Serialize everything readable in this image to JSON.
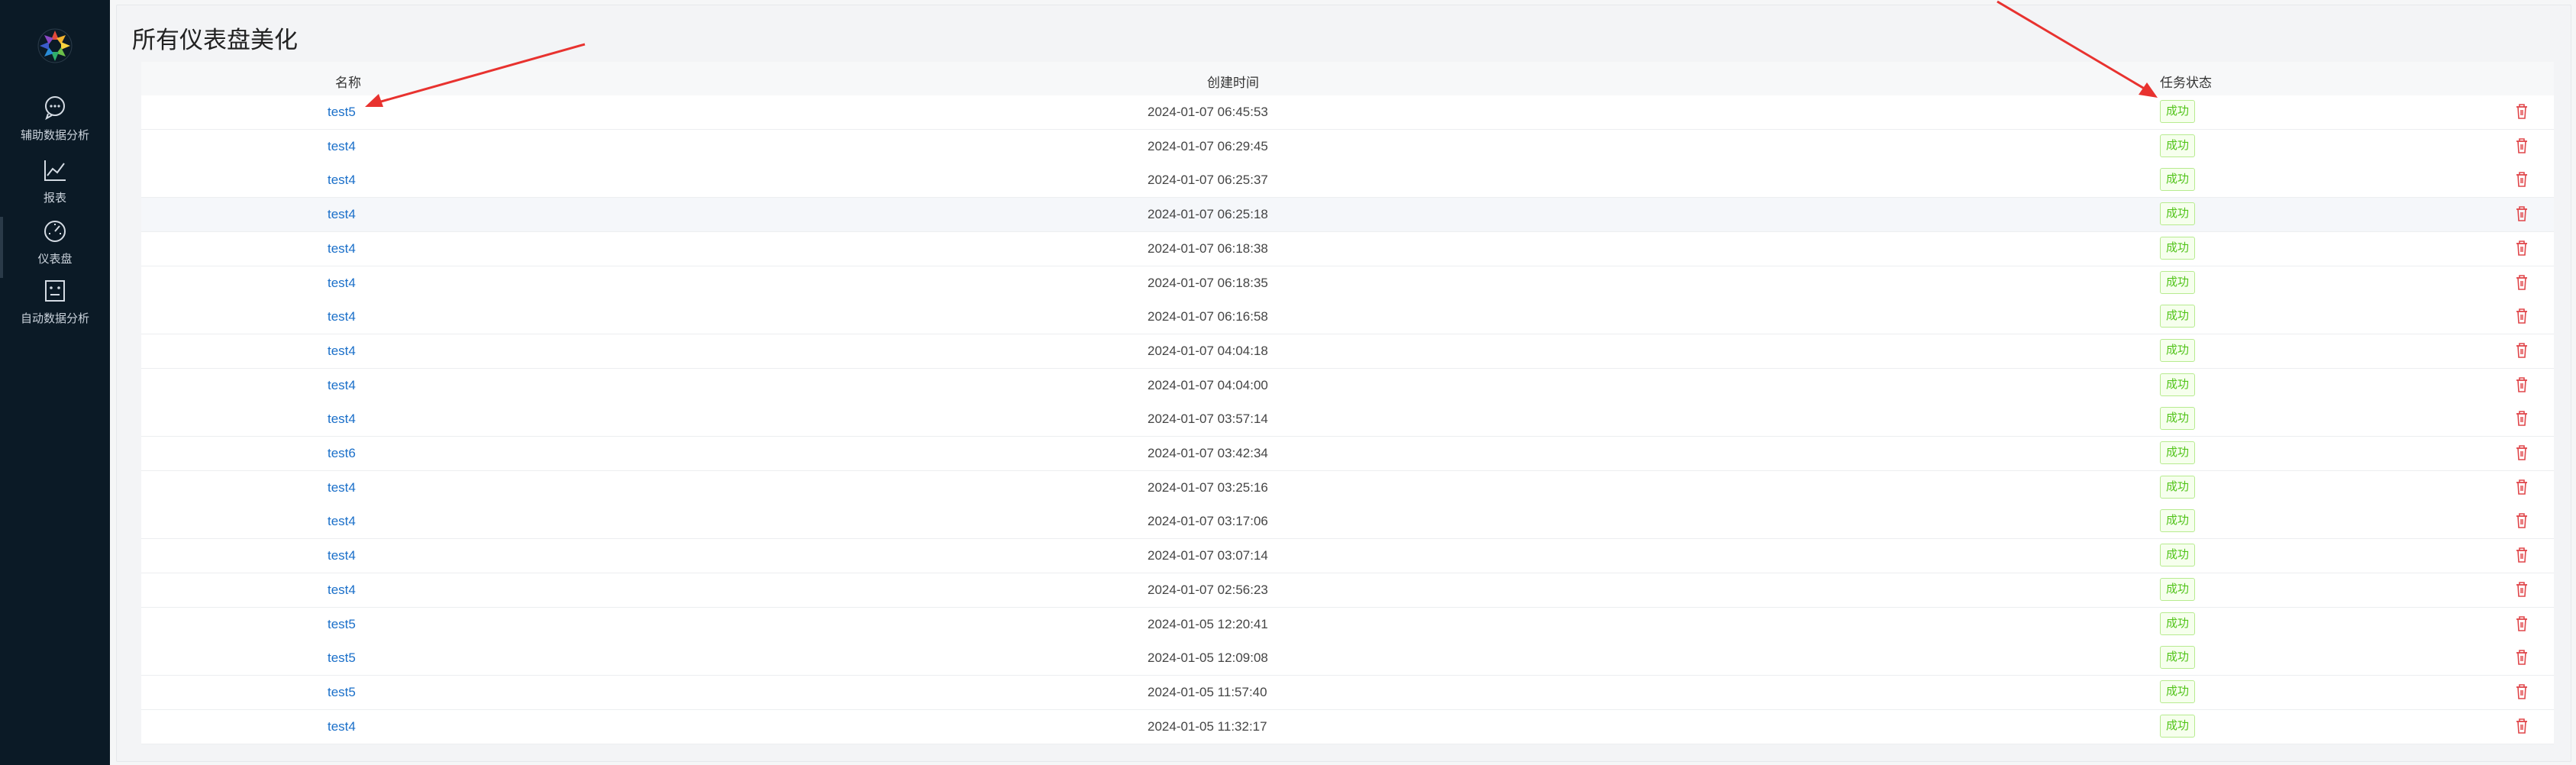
{
  "nav": [
    {
      "icon": "chat-icon",
      "label": "辅助数据分析",
      "active": false
    },
    {
      "icon": "line-chart-icon",
      "label": "报表",
      "active": false
    },
    {
      "icon": "dashboard-gauge-icon",
      "label": "仪表盘",
      "active": true
    },
    {
      "icon": "robot-icon",
      "label": "自动数据分析",
      "active": false
    }
  ],
  "page": {
    "title": "所有仪表盘美化"
  },
  "table": {
    "headers": {
      "name": "名称",
      "created": "创建时间",
      "status": "任务状态"
    },
    "rows": [
      {
        "name": "test5",
        "created": "2024-01-07 06:45:53",
        "status": "成功"
      },
      {
        "name": "test4",
        "created": "2024-01-07 06:29:45",
        "status": "成功"
      },
      {
        "name": "test4",
        "created": "2024-01-07 06:25:37",
        "status": "成功"
      },
      {
        "name": "test4",
        "created": "2024-01-07 06:25:18",
        "status": "成功"
      },
      {
        "name": "test4",
        "created": "2024-01-07 06:18:38",
        "status": "成功"
      },
      {
        "name": "test4",
        "created": "2024-01-07 06:18:35",
        "status": "成功"
      },
      {
        "name": "test4",
        "created": "2024-01-07 06:16:58",
        "status": "成功"
      },
      {
        "name": "test4",
        "created": "2024-01-07 04:04:18",
        "status": "成功"
      },
      {
        "name": "test4",
        "created": "2024-01-07 04:04:00",
        "status": "成功"
      },
      {
        "name": "test4",
        "created": "2024-01-07 03:57:14",
        "status": "成功"
      },
      {
        "name": "test6",
        "created": "2024-01-07 03:42:34",
        "status": "成功"
      },
      {
        "name": "test4",
        "created": "2024-01-07 03:25:16",
        "status": "成功"
      },
      {
        "name": "test4",
        "created": "2024-01-07 03:17:06",
        "status": "成功"
      },
      {
        "name": "test4",
        "created": "2024-01-07 03:07:14",
        "status": "成功"
      },
      {
        "name": "test4",
        "created": "2024-01-07 02:56:23",
        "status": "成功"
      },
      {
        "name": "test5",
        "created": "2024-01-05 12:20:41",
        "status": "成功"
      },
      {
        "name": "test5",
        "created": "2024-01-05 12:09:08",
        "status": "成功"
      },
      {
        "name": "test5",
        "created": "2024-01-05 11:57:40",
        "status": "成功"
      },
      {
        "name": "test4",
        "created": "2024-01-05 11:32:17",
        "status": "成功"
      }
    ]
  },
  "colors": {
    "sidebar": "#0b1a26",
    "link": "#1a6fc9",
    "success": "#52c41a",
    "danger": "#e0464a",
    "annotation": "#e8322f"
  }
}
